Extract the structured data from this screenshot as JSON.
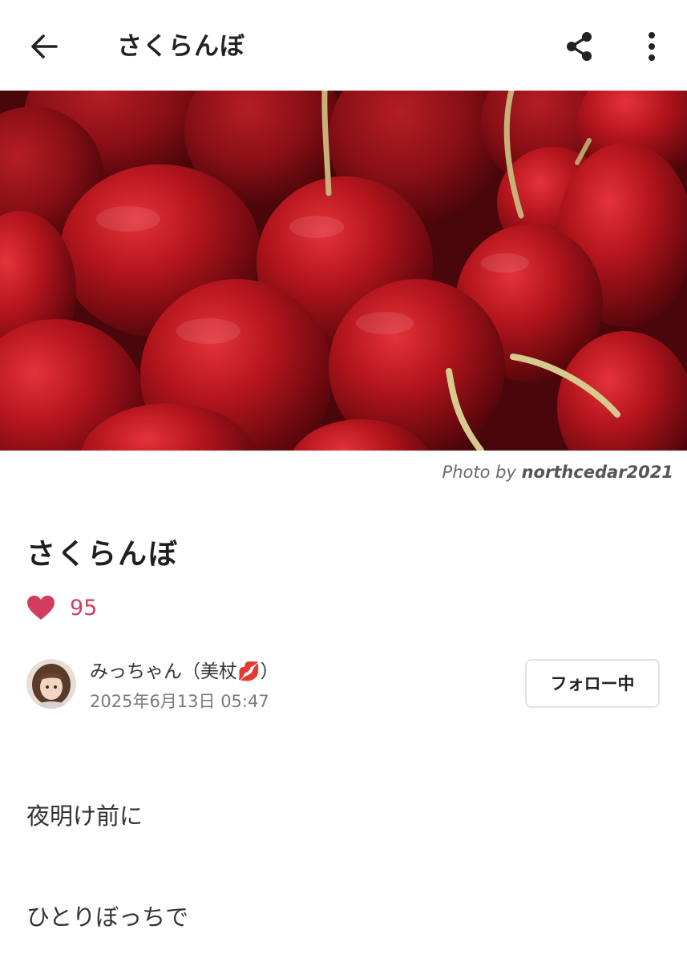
{
  "header": {
    "title": "さくらんぼ",
    "back_icon": "arrow-left-icon",
    "share_icon": "share-icon",
    "more_icon": "more-vertical-icon"
  },
  "photo": {
    "credit_prefix": "Photo by",
    "credit_author": "northcedar2021"
  },
  "post": {
    "title": "さくらんぼ",
    "like_icon": "heart-icon",
    "like_count": "95",
    "body_lines": [
      "夜明け前に",
      "ひとりぼっちで"
    ]
  },
  "author": {
    "name": "みっちゃん（美杖💋）",
    "date": "2025年6月13日 05:47",
    "follow_label": "フォロー中"
  },
  "colors": {
    "like_accent": "#d23c5e",
    "cherry_red": "#c41a1f",
    "text": "#222222",
    "muted": "#7a7a7a"
  }
}
